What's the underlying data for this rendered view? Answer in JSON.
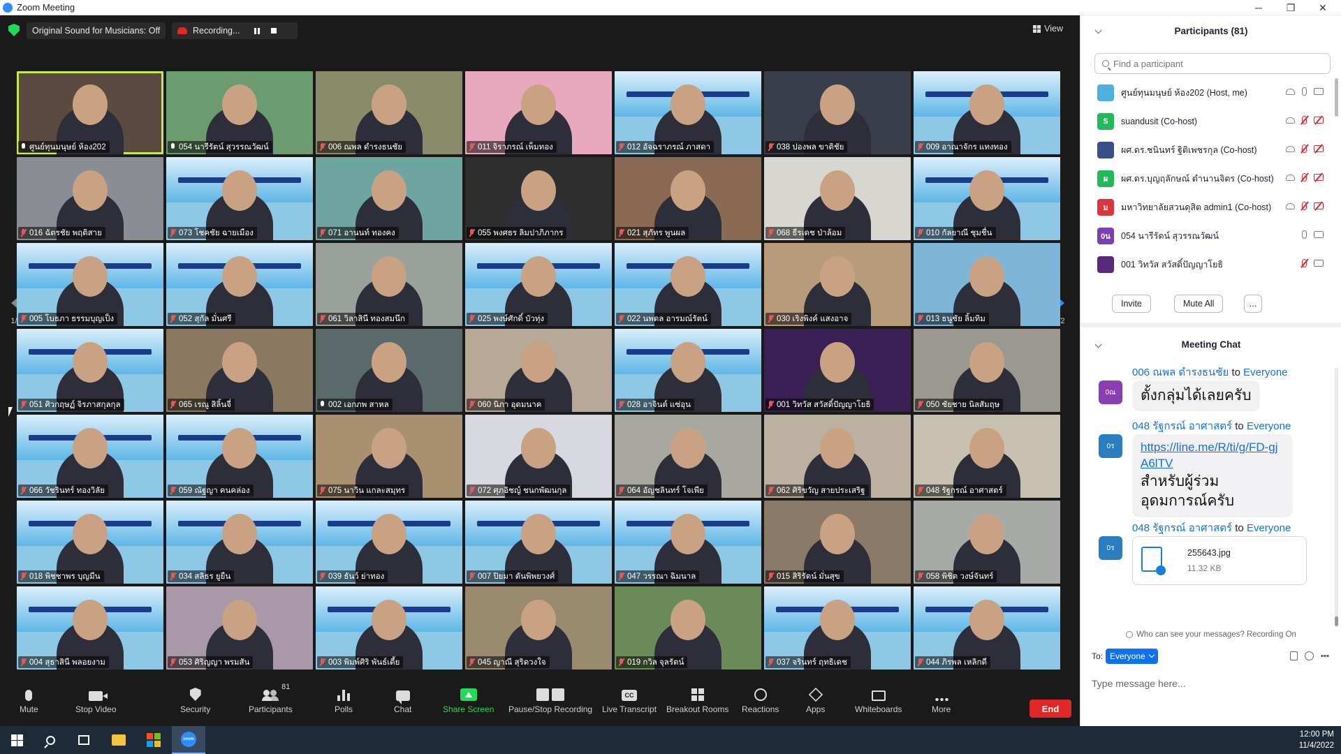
{
  "window": {
    "title": "Zoom Meeting",
    "controls": [
      "minimize",
      "maximize",
      "close"
    ]
  },
  "topbar": {
    "original_sound": "Original Sound for Musicians: Off",
    "recording_label": "Recording...",
    "view_label": "View"
  },
  "gallery": {
    "page_indicator": "1/2",
    "tiles": [
      {
        "name": "ศูนย์ทุนมนุษย์ ห้อง202",
        "muted": false,
        "bg": "#5a4a3f",
        "active": true,
        "banner": false
      },
      {
        "name": "054 นารีรัตน์ สุวรรณวัฒน์",
        "muted": false,
        "bg": "#6b9b6e",
        "active": false,
        "banner": false
      },
      {
        "name": "006 ณพล ดำรงธนชัย",
        "muted": true,
        "bg": "#8a8b6a",
        "active": false,
        "banner": false
      },
      {
        "name": "011 จิราภรณ์ เพ็มทอง",
        "muted": true,
        "bg": "#e8a8bd",
        "active": false,
        "banner": false
      },
      {
        "name": "012 อัจฉราภรณ์ ภาสดา",
        "muted": true,
        "bg": "#8fc8e6",
        "active": false,
        "banner": true
      },
      {
        "name": "038 ปองพล ขาติชัย",
        "muted": true,
        "bg": "#3a3e4a",
        "active": false,
        "banner": false
      },
      {
        "name": "009 อาณาจักร แทงทอง",
        "muted": true,
        "bg": "#8fc8e6",
        "active": false,
        "banner": true
      },
      {
        "name": "016 ฉัตรชัย พฤติสาย",
        "muted": true,
        "bg": "#8a8d93",
        "active": false,
        "banner": false
      },
      {
        "name": "073 โชคชัย ฉายเมือง",
        "muted": true,
        "bg": "#8fc8e6",
        "active": false,
        "banner": true
      },
      {
        "name": "071 อานนท์ ทองคง",
        "muted": true,
        "bg": "#6fa5a0",
        "active": false,
        "banner": false
      },
      {
        "name": "055 พงศธร ลิมปาภิภากร",
        "muted": true,
        "bg": "#2e2e2e",
        "active": false,
        "banner": false
      },
      {
        "name": "021 สุภัทร พูนผล",
        "muted": true,
        "bg": "#8a6a55",
        "active": false,
        "banner": false
      },
      {
        "name": "068 ธีรเดช ป่าล้อม",
        "muted": true,
        "bg": "#d8d6d0",
        "active": false,
        "banner": false
      },
      {
        "name": "010 กัลยาณี ชุมชื่น",
        "muted": true,
        "bg": "#8fc8e6",
        "active": false,
        "banner": true
      },
      {
        "name": "005 โบธภา ธรรมบุญเป็ง",
        "muted": true,
        "bg": "#8fc8e6",
        "active": false,
        "banner": true
      },
      {
        "name": "052 สุกัล มั่นศรี",
        "muted": true,
        "bg": "#8fc8e6",
        "active": false,
        "banner": true
      },
      {
        "name": "061 วิลาสินี ทองสมนึก",
        "muted": true,
        "bg": "#9aa09a",
        "active": false,
        "banner": false
      },
      {
        "name": "025 พงษ์ศักดิ์ บัวทุ่ง",
        "muted": true,
        "bg": "#8fc8e6",
        "active": false,
        "banner": true
      },
      {
        "name": "022 นพดล อารมณ์รัตน์",
        "muted": true,
        "bg": "#8fc8e6",
        "active": false,
        "banner": true
      },
      {
        "name": "030 เริงพิงค์ แสงอาจ",
        "muted": true,
        "bg": "#b89a7d",
        "active": false,
        "banner": false
      },
      {
        "name": "013 ธนูชัย ลิ้มทิม",
        "muted": true,
        "bg": "#7fb5d8",
        "active": false,
        "banner": false
      },
      {
        "name": "051 ศิวกฤษฏ์ จิรภาสกุลกุล",
        "muted": true,
        "bg": "#8fc8e6",
        "active": false,
        "banner": true
      },
      {
        "name": "065 เรณู สิลิ้นจี่",
        "muted": true,
        "bg": "#8a7860",
        "active": false,
        "banner": false
      },
      {
        "name": "002 เอกภพ สาหล",
        "muted": false,
        "bg": "#5a6a6a",
        "active": false,
        "banner": false
      },
      {
        "name": "060 นิภา อุดมนาค",
        "muted": true,
        "bg": "#b8a898",
        "active": false,
        "banner": false
      },
      {
        "name": "028 อาจินต์ แซ่อุน",
        "muted": true,
        "bg": "#8fc8e6",
        "active": false,
        "banner": true
      },
      {
        "name": "001 วิทวัส สวัสดิ์ปัญญาโยธิ",
        "muted": true,
        "bg": "#3a1f55",
        "active": false,
        "banner": false
      },
      {
        "name": "050 ชัยชาย นิลสัมฤษ",
        "muted": true,
        "bg": "#9a9890",
        "active": false,
        "banner": false
      },
      {
        "name": "066 วัชรินทร์ ทองวิลัย",
        "muted": true,
        "bg": "#8fc8e6",
        "active": false,
        "banner": true
      },
      {
        "name": "059 ณัฐญา คนคล่อง",
        "muted": true,
        "bg": "#8fc8e6",
        "active": false,
        "banner": true
      },
      {
        "name": "075 นาวิน แกละสมุทร",
        "muted": true,
        "bg": "#a89070",
        "active": false,
        "banner": false
      },
      {
        "name": "072 ศุภอิชญ์ ชนกพัฒนกุล",
        "muted": true,
        "bg": "#d8d8e0",
        "active": false,
        "banner": false
      },
      {
        "name": "064 อัญชลินทร์ โจเพีย",
        "muted": true,
        "bg": "#a8a8a0",
        "active": false,
        "banner": false
      },
      {
        "name": "062 ศิริขวัญ สายประเสริฐ",
        "muted": true,
        "bg": "#bcb0a0",
        "active": false,
        "banner": false
      },
      {
        "name": "048 รัฐกรณ์ อาศาสตร์",
        "muted": true,
        "bg": "#c8c0b0",
        "active": false,
        "banner": false
      },
      {
        "name": "018 พิชชาพร บุญมีน",
        "muted": true,
        "bg": "#8fc8e6",
        "active": false,
        "banner": true
      },
      {
        "name": "034 สลิธร ยูยืน",
        "muted": true,
        "bg": "#8fc8e6",
        "active": false,
        "banner": true
      },
      {
        "name": "039 ธันว์ ย่าทอง",
        "muted": true,
        "bg": "#8fc8e6",
        "active": false,
        "banner": true
      },
      {
        "name": "007 ปิยมา ตันพิพยวงศ์",
        "muted": true,
        "bg": "#8fc8e6",
        "active": false,
        "banner": true
      },
      {
        "name": "047 วรรณา ฉิมนาล",
        "muted": true,
        "bg": "#8fc8e6",
        "active": false,
        "banner": true
      },
      {
        "name": "015 สิริรัตน์ มั่นสุข",
        "muted": true,
        "bg": "#8a7a68",
        "active": false,
        "banner": false
      },
      {
        "name": "058 พิชิต วงษ์จันทร์",
        "muted": true,
        "bg": "#a8aaa8",
        "active": false,
        "banner": false
      },
      {
        "name": "004 สุธาสินี พลอยงาม",
        "muted": true,
        "bg": "#8fc8e6",
        "active": false,
        "banner": true
      },
      {
        "name": "053 ศิริญญา พรมสัน",
        "muted": true,
        "bg": "#a898a8",
        "active": false,
        "banner": false
      },
      {
        "name": "003 พิมพ์ศิริ พันธ์เตี้ย",
        "muted": true,
        "bg": "#8fc8e6",
        "active": false,
        "banner": true
      },
      {
        "name": "045 ญาณี สุริดวงใจ",
        "muted": true,
        "bg": "#9a8a70",
        "active": false,
        "banner": false
      },
      {
        "name": "019 กวิล จุลรัตน์",
        "muted": true,
        "bg": "#6a8a5a",
        "active": false,
        "banner": false
      },
      {
        "name": "037 จรินทร์ ฤทธิเดช",
        "muted": true,
        "bg": "#8fc8e6",
        "active": false,
        "banner": true
      },
      {
        "name": "044 ภิรพล เหลิกดี",
        "muted": true,
        "bg": "#8fc8e6",
        "active": false,
        "banner": true
      }
    ]
  },
  "toolbar": {
    "mute": "Mute",
    "stop_video": "Stop Video",
    "security": "Security",
    "participants": "Participants",
    "participants_count": "81",
    "polls": "Polls",
    "chat": "Chat",
    "share_screen": "Share Screen",
    "pause_stop_recording": "Pause/Stop Recording",
    "live_transcript": "Live Transcript",
    "breakout_rooms": "Breakout Rooms",
    "reactions": "Reactions",
    "apps": "Apps",
    "whiteboards": "Whiteboards",
    "more": "More",
    "end": "End",
    "cc": "CC"
  },
  "participants_panel": {
    "title": "Participants (81)",
    "search_placeholder": "Find a participant",
    "rows": [
      {
        "name": "ศูนย์ทุนมนุษย์ ห้อง202 (Host, me)",
        "avatar_text": "",
        "avatar_color": "#4fb0e0",
        "rec": true,
        "mic_off": false,
        "cam_off": false
      },
      {
        "name": "suandusit (Co-host)",
        "avatar_text": "S",
        "avatar_color": "#23b85a",
        "rec": true,
        "mic_off": true,
        "cam_off": true
      },
      {
        "name": "ผศ.ดร.ชนินทร์ ฐิติเพชรกุล (Co-host)",
        "avatar_text": "",
        "avatar_color": "#3a4f8a",
        "rec": true,
        "mic_off": true,
        "cam_off": true
      },
      {
        "name": "ผศ.ดร.บุญฤลักษณ์ ตำนานจิตร (Co-host)",
        "avatar_text": "ผ",
        "avatar_color": "#23b85a",
        "rec": true,
        "mic_off": true,
        "cam_off": true
      },
      {
        "name": "มหาวิทยาลัยสวนดุสิต admin1 (Co-host)",
        "avatar_text": "ม",
        "avatar_color": "#d9363e",
        "rec": true,
        "mic_off": true,
        "cam_off": true
      },
      {
        "name": "054 นารีรัตน์ สุวรรณวัฒน์",
        "avatar_text": "0น",
        "avatar_color": "#7a3fb0",
        "rec": false,
        "mic_off": false,
        "cam_off": false
      },
      {
        "name": "001 วิทวัส สวัสดิ์ปัญญาโยธิ",
        "avatar_text": "",
        "avatar_color": "#5a2a7a",
        "rec": false,
        "mic_off": true,
        "cam_off": false
      }
    ],
    "invite": "Invite",
    "mute_all": "Mute All",
    "more": "..."
  },
  "chat_panel": {
    "title": "Meeting Chat",
    "to_word": "to",
    "messages": [
      {
        "sender": "006 ณพล ดำรงธนชัย",
        "target": "Everyone",
        "avatar_text": "0ณ",
        "avatar_color": "#8a3fb0",
        "text": "ตั้งกลุ่มได้เลยครับ"
      },
      {
        "sender": "048 รัฐกรณ์ อาศาสตร์",
        "target": "Everyone",
        "avatar_text": "0ร",
        "avatar_color": "#2a7ec0",
        "link": "https://line.me/R/ti/g/FD-gjA6lTV",
        "text": "สำหรับผู้ร่วมอุดมการณ์ครับ"
      },
      {
        "sender": "048 รัฐกรณ์ อาศาสตร์",
        "target": "Everyone",
        "avatar_text": "0ร",
        "avatar_color": "#2a7ec0",
        "file_name": "255643.jpg",
        "file_size": "11.32 KB"
      }
    ],
    "who_can_see": "Who can see your messages? Recording On",
    "to_label": "To:",
    "to_value": "Everyone",
    "input_placeholder": "Type message here..."
  },
  "taskbar": {
    "time": "12:00 PM",
    "date": "11/4/2022",
    "zoom_label": "zoom"
  },
  "colors": {
    "accent": "#0e72ed",
    "end_red": "#e02828",
    "share_green": "#23d959",
    "active_speaker": "#c8e94a"
  }
}
